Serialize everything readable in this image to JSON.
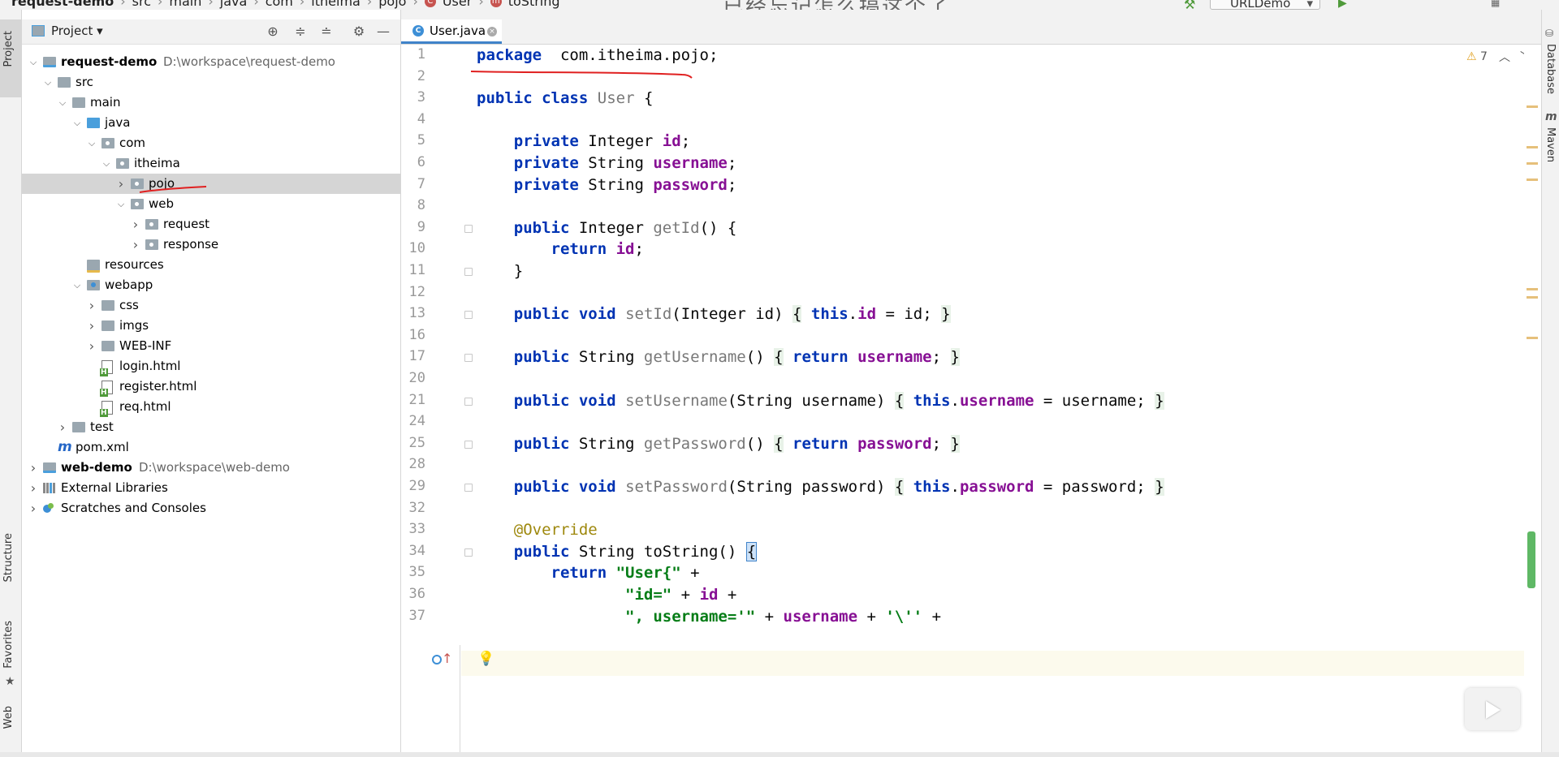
{
  "breadcrumb": {
    "project": "request-demo",
    "parts": [
      "src",
      "main",
      "java",
      "com",
      "itheima",
      "pojo",
      "User",
      "toString"
    ]
  },
  "overlay_text": "已经忘记怎么搞这个了",
  "run_config": "URLDemo",
  "left_tabs": {
    "project": "Project",
    "structure": "Structure",
    "favorites": "Favorites",
    "web": "Web"
  },
  "right_tabs": {
    "database": "Database",
    "maven": "Maven"
  },
  "project_panel": {
    "title": "Project",
    "tree": [
      {
        "label": "request-demo",
        "path": "D:\\workspace\\request-demo",
        "depth": 0,
        "arrow": "down",
        "icon": "module",
        "bold": true
      },
      {
        "label": "src",
        "depth": 1,
        "arrow": "down",
        "icon": "folder"
      },
      {
        "label": "main",
        "depth": 2,
        "arrow": "down",
        "icon": "folder"
      },
      {
        "label": "java",
        "depth": 3,
        "arrow": "down",
        "icon": "source-folder"
      },
      {
        "label": "com",
        "depth": 4,
        "arrow": "down",
        "icon": "package"
      },
      {
        "label": "itheima",
        "depth": 5,
        "arrow": "down",
        "icon": "package"
      },
      {
        "label": "pojo",
        "depth": 6,
        "arrow": "right",
        "icon": "package",
        "selected": true
      },
      {
        "label": "web",
        "depth": 6,
        "arrow": "down",
        "icon": "package"
      },
      {
        "label": "request",
        "depth": 7,
        "arrow": "right",
        "icon": "package"
      },
      {
        "label": "response",
        "depth": 7,
        "arrow": "right",
        "icon": "package"
      },
      {
        "label": "resources",
        "depth": 3,
        "arrow": "",
        "icon": "resources"
      },
      {
        "label": "webapp",
        "depth": 3,
        "arrow": "down",
        "icon": "web"
      },
      {
        "label": "css",
        "depth": 4,
        "arrow": "right",
        "icon": "folder"
      },
      {
        "label": "imgs",
        "depth": 4,
        "arrow": "right",
        "icon": "folder"
      },
      {
        "label": "WEB-INF",
        "depth": 4,
        "arrow": "right",
        "icon": "folder"
      },
      {
        "label": "login.html",
        "depth": 4,
        "arrow": "",
        "icon": "html"
      },
      {
        "label": "register.html",
        "depth": 4,
        "arrow": "",
        "icon": "html"
      },
      {
        "label": "req.html",
        "depth": 4,
        "arrow": "",
        "icon": "html"
      },
      {
        "label": "test",
        "depth": 2,
        "arrow": "right",
        "icon": "folder"
      },
      {
        "label": "pom.xml",
        "depth": 1,
        "arrow": "",
        "icon": "maven"
      },
      {
        "label": "web-demo",
        "path": "D:\\workspace\\web-demo",
        "depth": 0,
        "arrow": "right",
        "icon": "module",
        "bold": true
      },
      {
        "label": "External Libraries",
        "depth": 0,
        "arrow": "right",
        "icon": "libraries"
      },
      {
        "label": "Scratches and Consoles",
        "depth": 0,
        "arrow": "right",
        "icon": "scratches"
      }
    ]
  },
  "editor": {
    "tab_label": "User.java",
    "warnings": "7",
    "lines": [
      {
        "n": "1",
        "tokens": [
          [
            "kw",
            "package"
          ],
          [
            "",
            "  com.itheima.pojo;"
          ]
        ]
      },
      {
        "n": "2",
        "tokens": []
      },
      {
        "n": "3",
        "tokens": [
          [
            "kw",
            "public"
          ],
          [
            "",
            " "
          ],
          [
            "kw",
            "class"
          ],
          [
            "",
            " "
          ],
          [
            "cls",
            "User"
          ],
          [
            "",
            " {"
          ]
        ]
      },
      {
        "n": "4",
        "tokens": []
      },
      {
        "n": "5",
        "tokens": [
          [
            "",
            "    "
          ],
          [
            "kw",
            "private"
          ],
          [
            "",
            " Integer "
          ],
          [
            "fld",
            "id"
          ],
          [
            "",
            ";"
          ]
        ]
      },
      {
        "n": "6",
        "tokens": [
          [
            "",
            "    "
          ],
          [
            "kw",
            "private"
          ],
          [
            "",
            " String "
          ],
          [
            "fld",
            "username"
          ],
          [
            "",
            ";"
          ]
        ]
      },
      {
        "n": "7",
        "tokens": [
          [
            "",
            "    "
          ],
          [
            "kw",
            "private"
          ],
          [
            "",
            " String "
          ],
          [
            "fld",
            "password"
          ],
          [
            "",
            ";"
          ]
        ]
      },
      {
        "n": "8",
        "tokens": []
      },
      {
        "n": "9",
        "tokens": [
          [
            "",
            "    "
          ],
          [
            "kw",
            "public"
          ],
          [
            "",
            " Integer "
          ],
          [
            "mth",
            "getId"
          ],
          [
            "",
            "() {"
          ]
        ],
        "fold": true
      },
      {
        "n": "10",
        "tokens": [
          [
            "",
            "        "
          ],
          [
            "kw",
            "return"
          ],
          [
            "",
            " "
          ],
          [
            "fld",
            "id"
          ],
          [
            "",
            ";"
          ]
        ]
      },
      {
        "n": "11",
        "tokens": [
          [
            "",
            "    }"
          ]
        ],
        "fold": true
      },
      {
        "n": "12",
        "tokens": []
      },
      {
        "n": "13",
        "tokens": [
          [
            "",
            "    "
          ],
          [
            "kw",
            "public"
          ],
          [
            "",
            " "
          ],
          [
            "kw",
            "void"
          ],
          [
            "",
            " "
          ],
          [
            "mth",
            "setId"
          ],
          [
            "",
            "(Integer id) "
          ],
          [
            "fbr",
            "{"
          ],
          [
            "",
            " "
          ],
          [
            "kw",
            "this"
          ],
          [
            "",
            "."
          ],
          [
            "fld",
            "id"
          ],
          [
            "",
            " = id; "
          ],
          [
            "fbr",
            "}"
          ]
        ],
        "fold": true
      },
      {
        "n": "16",
        "tokens": []
      },
      {
        "n": "17",
        "tokens": [
          [
            "",
            "    "
          ],
          [
            "kw",
            "public"
          ],
          [
            "",
            " String "
          ],
          [
            "mth",
            "getUsername"
          ],
          [
            "",
            "() "
          ],
          [
            "fbr",
            "{"
          ],
          [
            "",
            " "
          ],
          [
            "kw",
            "return"
          ],
          [
            "",
            " "
          ],
          [
            "fld",
            "username"
          ],
          [
            "",
            "; "
          ],
          [
            "fbr",
            "}"
          ]
        ],
        "fold": true
      },
      {
        "n": "20",
        "tokens": []
      },
      {
        "n": "21",
        "tokens": [
          [
            "",
            "    "
          ],
          [
            "kw",
            "public"
          ],
          [
            "",
            " "
          ],
          [
            "kw",
            "void"
          ],
          [
            "",
            " "
          ],
          [
            "mth",
            "setUsername"
          ],
          [
            "",
            "(String username) "
          ],
          [
            "fbr",
            "{"
          ],
          [
            "",
            " "
          ],
          [
            "kw",
            "this"
          ],
          [
            "",
            "."
          ],
          [
            "fld",
            "username"
          ],
          [
            "",
            " = username; "
          ],
          [
            "fbr",
            "}"
          ]
        ],
        "fold": true
      },
      {
        "n": "24",
        "tokens": []
      },
      {
        "n": "25",
        "tokens": [
          [
            "",
            "    "
          ],
          [
            "kw",
            "public"
          ],
          [
            "",
            " String "
          ],
          [
            "mth",
            "getPassword"
          ],
          [
            "",
            "() "
          ],
          [
            "fbr",
            "{"
          ],
          [
            "",
            " "
          ],
          [
            "kw",
            "return"
          ],
          [
            "",
            " "
          ],
          [
            "fld",
            "password"
          ],
          [
            "",
            "; "
          ],
          [
            "fbr",
            "}"
          ]
        ],
        "fold": true
      },
      {
        "n": "28",
        "tokens": []
      },
      {
        "n": "29",
        "tokens": [
          [
            "",
            "    "
          ],
          [
            "kw",
            "public"
          ],
          [
            "",
            " "
          ],
          [
            "kw",
            "void"
          ],
          [
            "",
            " "
          ],
          [
            "mth",
            "setPassword"
          ],
          [
            "",
            "(String password) "
          ],
          [
            "fbr",
            "{"
          ],
          [
            "",
            " "
          ],
          [
            "kw",
            "this"
          ],
          [
            "",
            "."
          ],
          [
            "fld",
            "password"
          ],
          [
            "",
            " = password; "
          ],
          [
            "fbr",
            "}"
          ]
        ],
        "fold": true
      },
      {
        "n": "32",
        "tokens": []
      },
      {
        "n": "33",
        "tokens": [
          [
            "",
            "    "
          ],
          [
            "ann",
            "@Override"
          ]
        ]
      },
      {
        "n": "34",
        "tokens": [
          [
            "",
            "    "
          ],
          [
            "kw",
            "public"
          ],
          [
            "",
            " String toString() "
          ],
          [
            "caret-br",
            "{"
          ]
        ],
        "fold": true,
        "current": true
      },
      {
        "n": "35",
        "tokens": [
          [
            "",
            "        "
          ],
          [
            "kw",
            "return"
          ],
          [
            "",
            " "
          ],
          [
            "str",
            "\"User{\""
          ],
          [
            "",
            " +"
          ]
        ]
      },
      {
        "n": "36",
        "tokens": [
          [
            "",
            "                "
          ],
          [
            "str",
            "\"id=\""
          ],
          [
            "",
            " + "
          ],
          [
            "fld",
            "id"
          ],
          [
            "",
            " +"
          ]
        ]
      },
      {
        "n": "37",
        "tokens": [
          [
            "",
            "                "
          ],
          [
            "str",
            "\", username='\""
          ],
          [
            "",
            " + "
          ],
          [
            "fld",
            "username"
          ],
          [
            "",
            " + "
          ],
          [
            "str",
            "'\\''"
          ],
          [
            "",
            " +"
          ]
        ]
      }
    ]
  },
  "colors": {
    "keyword": "#0033b3",
    "field": "#871094",
    "string": "#067d17",
    "annotation": "#9e880d",
    "selection": "#d5d5d5",
    "accent": "#4083c9",
    "annotation_ink": "#e02020"
  }
}
